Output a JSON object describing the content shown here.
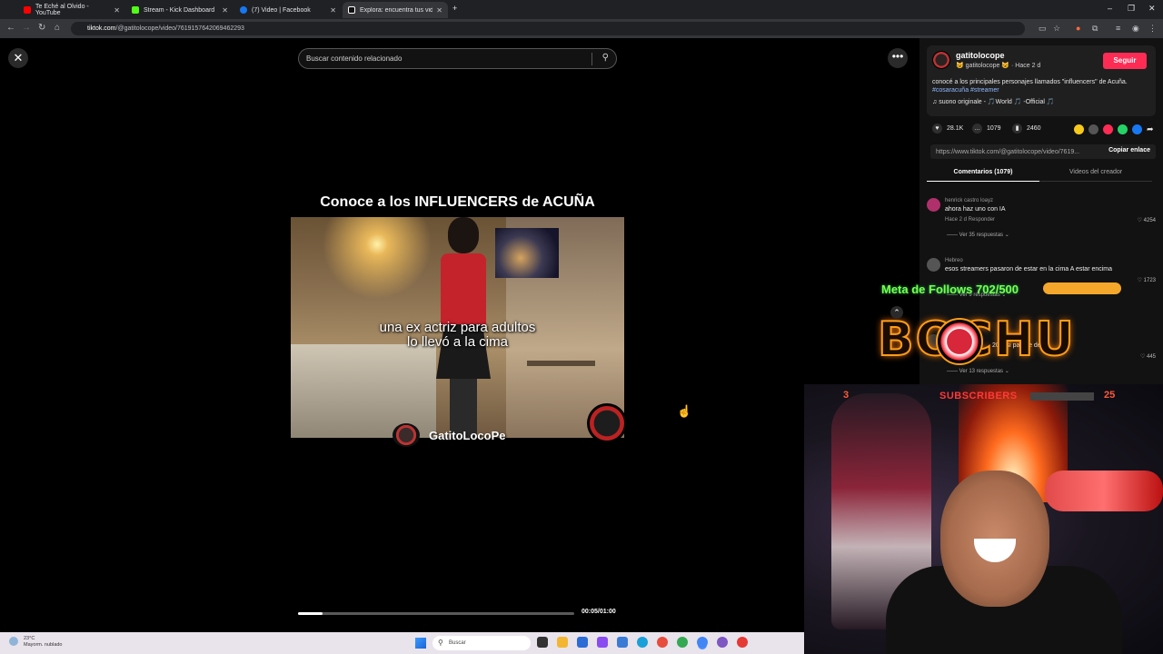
{
  "browser": {
    "tabs": [
      {
        "label": "Te Eché al Olvido - YouTube",
        "color": "#ff0000"
      },
      {
        "label": "Stream - Kick Dashboard",
        "color": "#53fc18"
      },
      {
        "label": "(7) Video | Facebook",
        "color": "#1877f2"
      },
      {
        "label": "Explora: encuentra tus vid...",
        "color": "#ffffff"
      }
    ],
    "new_tab": "+",
    "url_host": "tiktok.com",
    "url_path": "/@gatitolocope/video/7619157642069462293"
  },
  "player": {
    "close": "✕",
    "search_placeholder": "Buscar contenido relacionado",
    "headline": "Conoce a los INFLUENCERS de ACUÑA",
    "caption_line1": "una ex actriz para adultos",
    "caption_line2": "lo llevó a la cima",
    "watermark": "GatitoLocoPe",
    "time": "00:05/01:00",
    "progress": 0.09,
    "more": "•••"
  },
  "author": {
    "name": "gatitolocope",
    "sub": "😺 gatitolocope 😺 · Hace 2 d",
    "follow": "Seguir",
    "desc": "conocé a los principales personajes llamados \"influencers\" de Acuña.",
    "tags": "#cosaracuña #streamer",
    "music": "♫  suono originale - 🎵World 🎵 -Official 🎵"
  },
  "stats": {
    "likes": "28.1K",
    "comments": "1079",
    "saves": "2460"
  },
  "share_colors": [
    "#f6c91c",
    "#555555",
    "#fe2c55",
    "#25d366",
    "#1877f2"
  ],
  "link": {
    "url": "https://www.tiktok.com/@gatitolocope/video/7619...",
    "copy": "Copiar enlace"
  },
  "tabs": {
    "comments": "Comentarios (1079)",
    "videos": "Videos del creador"
  },
  "comments": [
    {
      "user": "henrick castro loayz",
      "text": "ahora haz uno con IA",
      "meta": "Hace 2 d    Responder",
      "likes": "♡ 4254",
      "replies": "——  Ver 35 respuestas ⌄",
      "color": "#b0306b"
    },
    {
      "user": "Hebreo",
      "text": "esos streamers pasaron de estar en la cima A estar encima",
      "meta": "",
      "likes": "♡ 1723",
      "replies": "——  Ver 9 respuestas ⌄",
      "color": "#555555"
    },
    {
      "user": "",
      "text": "20.1 si parece de 30",
      "meta": "",
      "likes": "♡ 445",
      "replies": "——  Ver 13 respuestas ⌄",
      "color": "#3a3a3a"
    }
  ],
  "overlay": {
    "goal": "Meta de Follows 702/500",
    "brand": "BOCHU",
    "sub_count": "3",
    "sub_label": "SUBSCRIBERS",
    "sub_goal": "25"
  },
  "taskbar": {
    "temp": "23°C",
    "weather": "Mayorm. nublado",
    "search": "Buscar"
  }
}
